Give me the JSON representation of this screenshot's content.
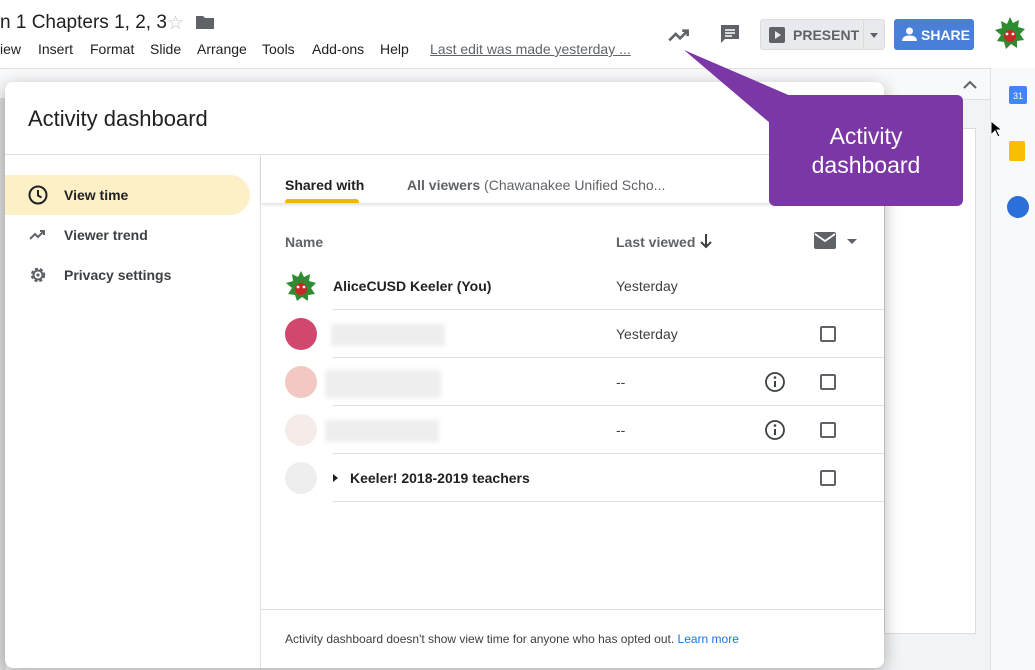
{
  "doc": {
    "title": "n 1 Chapters 1, 2, 3"
  },
  "menu": {
    "items": [
      "iew",
      "Insert",
      "Format",
      "Slide",
      "Arrange",
      "Tools",
      "Add-ons",
      "Help"
    ],
    "last_edit": "Last edit was made yesterday ..."
  },
  "header": {
    "present_label": "PRESENT",
    "share_label": "SHARE"
  },
  "sidebar_right": {
    "calendar_day": "31"
  },
  "dialog": {
    "title": "Activity dashboard",
    "nav": [
      {
        "label": "View time",
        "icon": "clock-icon",
        "active": true
      },
      {
        "label": "Viewer trend",
        "icon": "trending-up-icon",
        "active": false
      },
      {
        "label": "Privacy settings",
        "icon": "gear-icon",
        "active": false
      }
    ],
    "tabs": {
      "shared_with": "Shared with",
      "all_viewers": "All viewers",
      "all_viewers_sub": "(Chawanakee Unified Scho..."
    },
    "columns": {
      "name": "Name",
      "last_viewed": "Last viewed"
    },
    "rows": [
      {
        "name": "AliceCUSD Keeler (You)",
        "last_viewed": "Yesterday"
      },
      {
        "name": "",
        "last_viewed": "Yesterday"
      },
      {
        "name": "",
        "last_viewed": "--"
      },
      {
        "name": "",
        "last_viewed": "--"
      },
      {
        "name": "Keeler! 2018-2019 teachers",
        "last_viewed": ""
      }
    ],
    "footer_text": "Activity dashboard doesn't show view time for anyone who has opted out.",
    "footer_link": "Learn more"
  },
  "callout": {
    "line1": "Activity",
    "line2": "dashboard",
    "color": "#7b37a5"
  },
  "colors": {
    "share": "#4a7fd8",
    "active_nav": "#fdf0c7",
    "tab_underline": "#f4b400",
    "link": "#1a73e8"
  }
}
